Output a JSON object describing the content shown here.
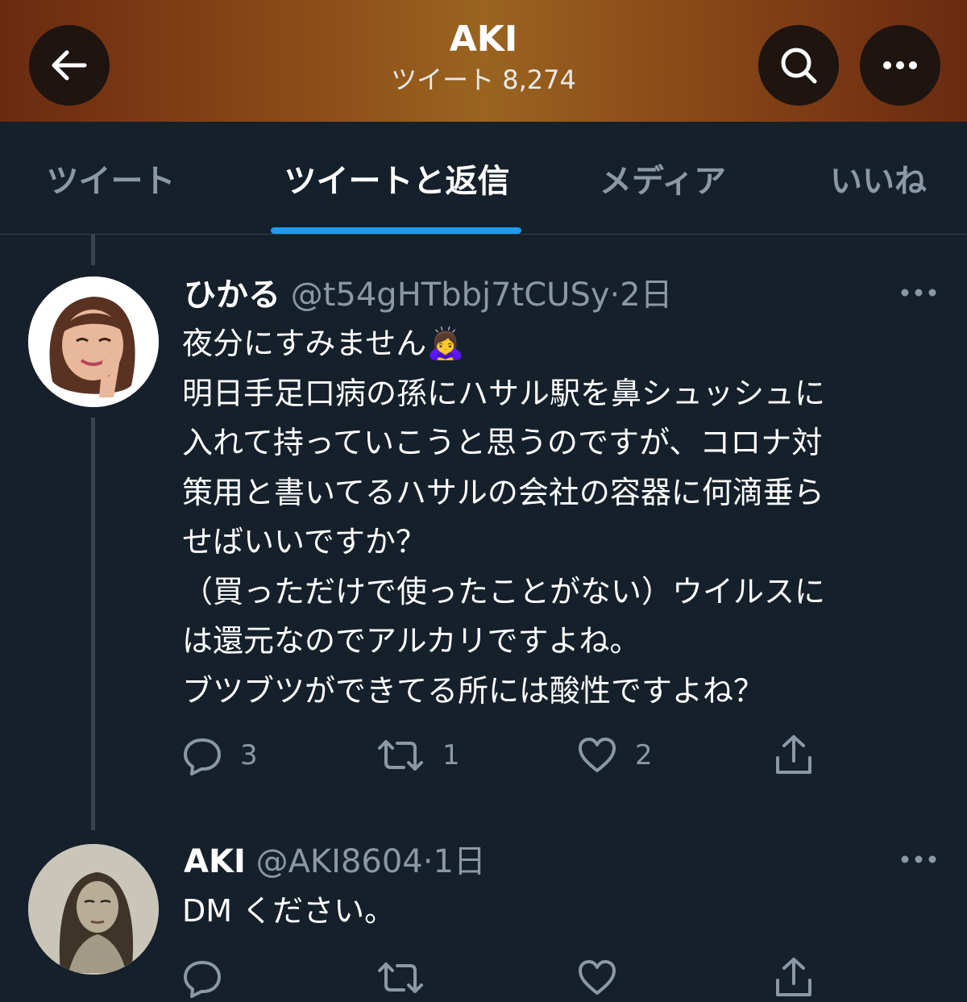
{
  "header": {
    "title": "AKI",
    "subtitle": "ツイート 8,274",
    "back_icon": "arrow-left-icon",
    "search_icon": "search-icon",
    "more_icon": "more-horizontal-icon"
  },
  "tabs": [
    {
      "label": "ツイート",
      "active": false
    },
    {
      "label": "ツイートと返信",
      "active": true
    },
    {
      "label": "メディア",
      "active": false
    },
    {
      "label": "いいね",
      "active": false
    }
  ],
  "colors": {
    "background": "#15202b",
    "accent": "#1d9bf0",
    "secondary_text": "#8b98a5",
    "divider": "#38444d"
  },
  "tweets": [
    {
      "name": "ひかる",
      "handle": "@t54gHTbbj7tCUSy",
      "separator": "·",
      "time": "2日",
      "emoji": "🙇‍♀️",
      "lines": [
        "夜分にすみません",
        "明日手足口病の孫にハサル駅を鼻シュッシュに",
        "入れて持っていこうと思うのですが、コロナ対",
        "策用と書いてるハサルの会社の容器に何滴垂ら",
        "せばいいですか？",
        "（買っただけで使ったことがない）ウイルスに",
        "は還元なのでアルカリですよね。",
        "ブツブツができてる所には酸性ですよね？"
      ],
      "replies": "3",
      "retweets": "1",
      "likes": "2"
    },
    {
      "name": "AKI",
      "handle": "@AKI8604",
      "separator": "·",
      "time": "1日",
      "lines": [
        "DM ください。"
      ],
      "replies": "",
      "retweets": "",
      "likes": ""
    }
  ]
}
